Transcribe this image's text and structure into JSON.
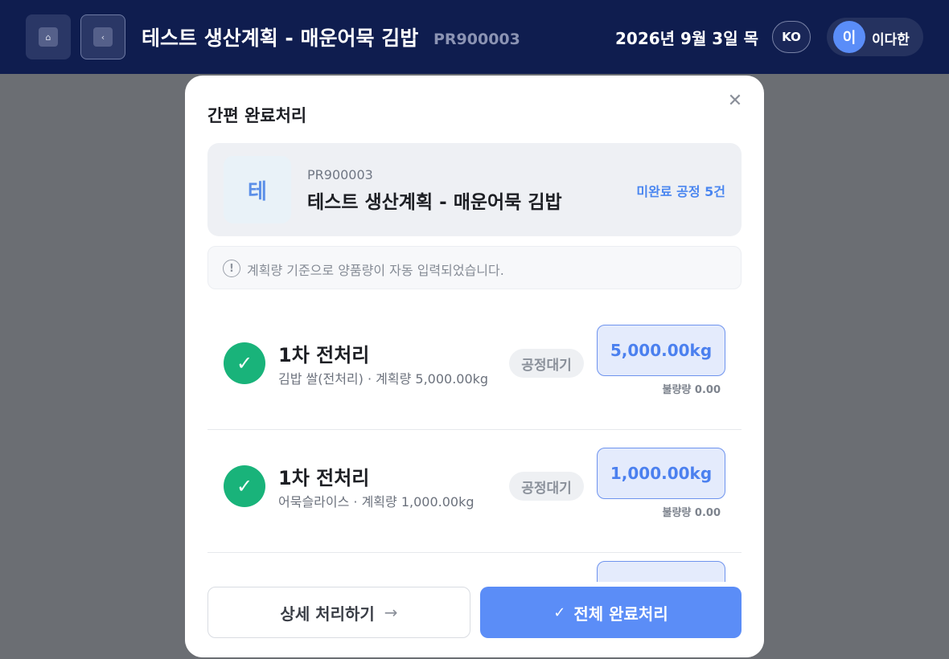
{
  "header": {
    "home_icon": "home-icon",
    "back_icon": "chevron-left-icon",
    "title": "테스트 생산계획 - 매운어묵 김밥",
    "code": "PR900003",
    "date": "2026년 9월 3일 목",
    "language": "KO",
    "user_initial": "이",
    "user_name": "이다한"
  },
  "modal": {
    "title": "간편 완료처리",
    "close_icon": "close-icon",
    "plan": {
      "avatar": "테",
      "code": "PR900003",
      "name": "테스트 생산계획 - 매운어묵 김밥",
      "pending": "미완료 공정 5건"
    },
    "notice": {
      "icon": "alert-circle-icon",
      "text": "계획량 기준으로 양품량이 자동 입력되었습니다."
    },
    "steps": [
      {
        "title": "1차 전처리",
        "desc": "김밥 쌀(전처리) · 계획량 5,000.00kg",
        "status": "공정대기",
        "qty": "5,000.00kg",
        "defect": "불량량 0.00"
      },
      {
        "title": "1차 전처리",
        "desc": "어묵슬라이스 · 계획량 1,000.00kg",
        "status": "공정대기",
        "qty": "1,000.00kg",
        "defect": "불량량 0.00"
      },
      {
        "title": "",
        "desc": "",
        "status": "",
        "qty": "",
        "defect": ""
      }
    ],
    "buttons": {
      "detail": "상세 처리하기",
      "complete": "전체 완료처리"
    }
  },
  "colors": {
    "topbar": "#0f1d4f",
    "accent": "#5b8df7",
    "success": "#19b37a"
  }
}
